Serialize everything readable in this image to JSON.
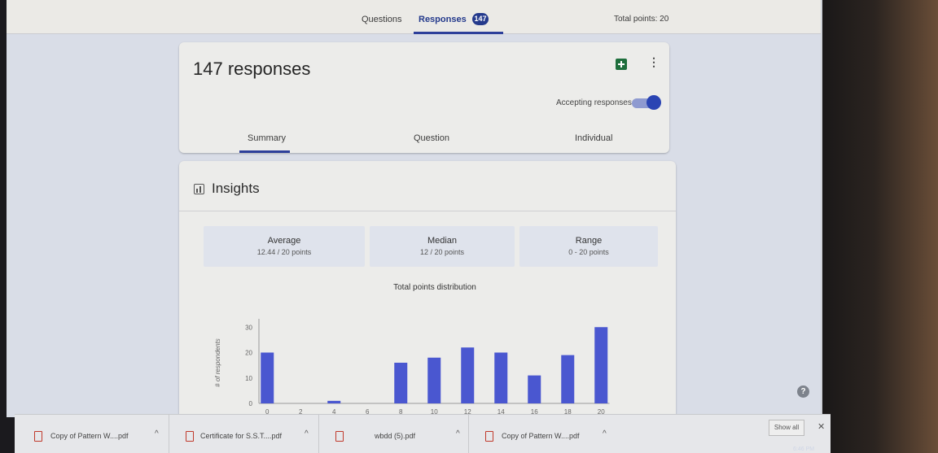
{
  "topbar": {
    "questions_tab": "Questions",
    "responses_tab": "Responses",
    "responses_badge": "147",
    "total_points": "Total points: 20"
  },
  "responses_card": {
    "title": "147 responses",
    "accepting_label": "Accepting responses",
    "accepting_on": true,
    "sheets_icon": "sheets-icon",
    "more_icon": "more-vert-icon",
    "tabs": [
      "Summary",
      "Question",
      "Individual"
    ],
    "active_tab": "Summary"
  },
  "insights": {
    "title": "Insights",
    "stats": [
      {
        "label": "Average",
        "value": "12.44 / 20 points"
      },
      {
        "label": "Median",
        "value": "12 / 20 points"
      },
      {
        "label": "Range",
        "value": "0 - 20 points"
      }
    ]
  },
  "chart_data": {
    "type": "bar",
    "title": "Total points distribution",
    "ylabel": "# of respondents",
    "xlabel": "",
    "x": [
      0,
      4,
      8,
      10,
      12,
      14,
      16,
      18,
      20
    ],
    "values": [
      20,
      1,
      16,
      18,
      22,
      20,
      11,
      19,
      30
    ],
    "x_ticks": [
      "0",
      "2",
      "4",
      "6",
      "8",
      "10",
      "12",
      "14",
      "16",
      "18",
      "20"
    ],
    "y_ticks": [
      "0",
      "10",
      "20",
      "30"
    ],
    "ylim": [
      0,
      32
    ],
    "color": "#4a57d0",
    "grid": false
  },
  "help_icon": "?",
  "downloads": {
    "items": [
      {
        "name": "Copy of Pattern W....pdf",
        "chevron": "^"
      },
      {
        "name": "Certificate for S.S.T....pdf",
        "chevron": "^"
      },
      {
        "name": "wbdd (5).pdf",
        "chevron": "^"
      },
      {
        "name": "Copy of Pattern W....pdf",
        "chevron": "^"
      }
    ],
    "show_all": "Show all",
    "close": "✕"
  },
  "taskbar_clock": "6:46 PM"
}
